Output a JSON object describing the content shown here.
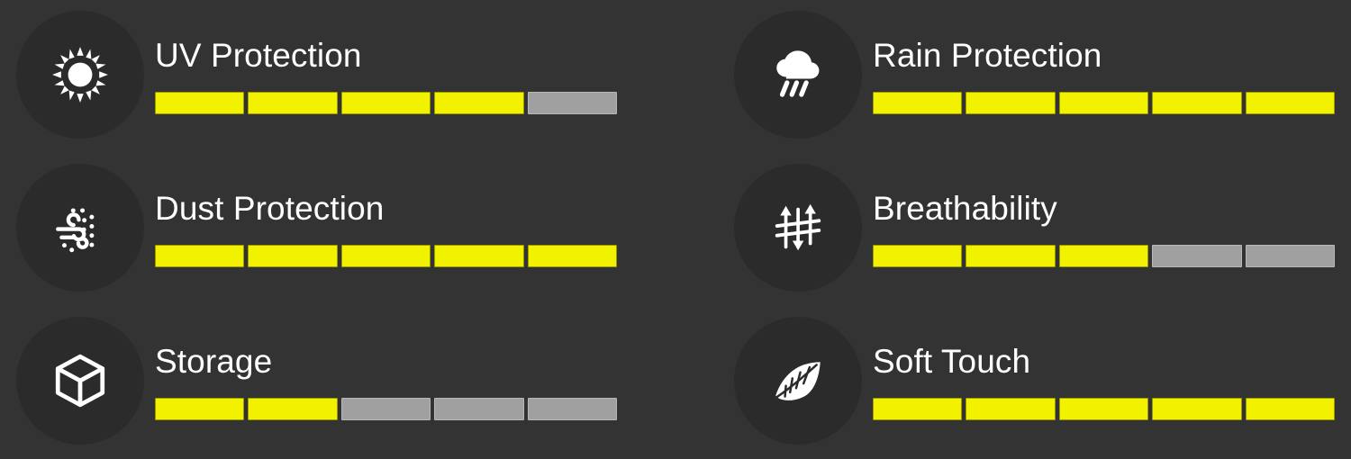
{
  "theme": {
    "background_color": "#333333",
    "badge_color": "#2B2B2B",
    "label_color": "#FFFFFF",
    "rating_filled_color": "#F2F200",
    "rating_empty_color": "#A0A0A0"
  },
  "rating_scale": {
    "max": 5,
    "style": "segmented-bar"
  },
  "features": [
    {
      "id": "uv-protection",
      "label": "UV Protection",
      "icon": "sun-icon",
      "rating": 4,
      "max": 5,
      "column": "left",
      "row": 0
    },
    {
      "id": "rain-protection",
      "label": "Rain Protection",
      "icon": "cloud-rain-icon",
      "rating": 5,
      "max": 5,
      "column": "right",
      "row": 0
    },
    {
      "id": "dust-protection",
      "label": "Dust Protection",
      "icon": "wind-dust-icon",
      "rating": 5,
      "max": 5,
      "column": "left",
      "row": 1
    },
    {
      "id": "breathability",
      "label": "Breathability",
      "icon": "airflow-arrows-icon",
      "rating": 3,
      "max": 5,
      "column": "right",
      "row": 1
    },
    {
      "id": "storage",
      "label": "Storage",
      "icon": "cube-box-icon",
      "rating": 2,
      "max": 5,
      "column": "left",
      "row": 2
    },
    {
      "id": "soft-touch",
      "label": "Soft Touch",
      "icon": "feather-icon",
      "rating": 5,
      "max": 5,
      "column": "right",
      "row": 2
    }
  ]
}
